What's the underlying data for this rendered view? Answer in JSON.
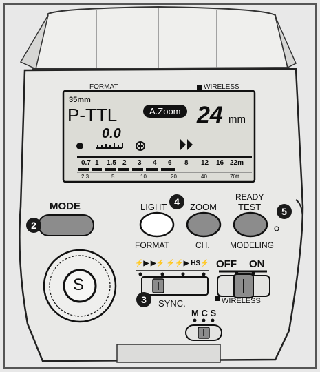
{
  "device": {
    "top_labels": {
      "format": "FORMAT",
      "wireless": "WIRELESS"
    },
    "lcd": {
      "focal_small": "35mm",
      "mode": "P-TTL",
      "zoom_badge": "A.Zoom",
      "focal_big": "24",
      "focal_unit": "mm",
      "ev_value": "0.0",
      "minus": "−",
      "plus": "+",
      "scale_m": [
        "0.7",
        "1",
        "1.5",
        "2",
        "3",
        "4",
        "6",
        "8",
        "12",
        "16",
        "22m"
      ],
      "scale_ft": [
        "2.3",
        "5",
        "10",
        "20",
        "40",
        "70ft"
      ]
    },
    "buttons": {
      "mode": "MODE",
      "light": "LIGHT",
      "format": "FORMAT",
      "zoom": "ZOOM",
      "ch": "CH.",
      "ready": "READY",
      "test": "TEST",
      "modeling": "MODELING",
      "select": "S"
    },
    "switches": {
      "sync_modes": "⚡▶ ▶⚡ ⚡⚡▶ HS⚡",
      "sync": "SYNC.",
      "off": "OFF",
      "on": "ON",
      "wireless": "WIRELESS",
      "mcs": "M C S"
    },
    "callouts": [
      "2",
      "3",
      "4",
      "5"
    ],
    "colors": {
      "button_gray": "#8c8c8c",
      "body": "#e9e9e7",
      "lcd": "#dcdcd6"
    }
  }
}
